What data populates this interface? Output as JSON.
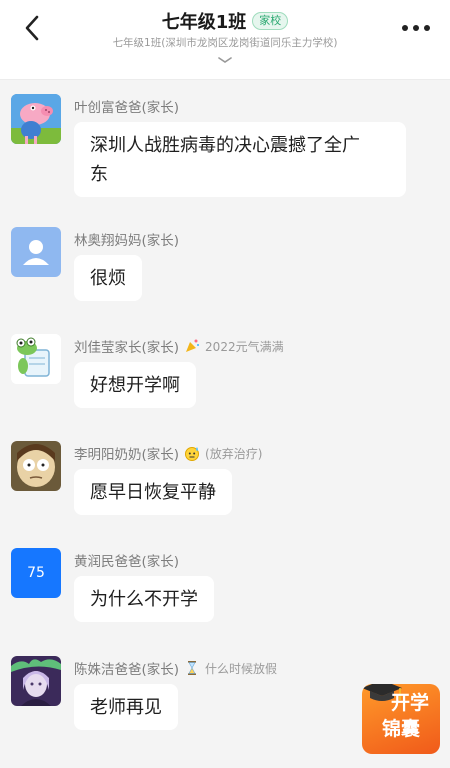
{
  "header": {
    "title": "七年级1班",
    "tag": "家校",
    "subtitle": "七年级1班(深圳市龙岗区龙岗街道同乐主力学校)",
    "back_icon": "chevron-left-icon",
    "more_icon": "more-dots-icon",
    "collapse_icon": "chevron-down-icon"
  },
  "messages": [
    {
      "sender": "叶创富爸爸(家长)",
      "text": "深圳人战胜病毒的决心震撼了全广东",
      "text_line1": "深圳人战胜病毒的决心震撼了全广",
      "text_line2": "东",
      "avatar": "peppa-pig-avatar"
    },
    {
      "sender": "林奥翔妈妈(家长)",
      "text": "很烦",
      "avatar": "default-person-avatar"
    },
    {
      "sender": "刘佳莹家长(家长)",
      "badge": "2022元气满满",
      "text": "好想开学啊",
      "avatar": "frog-cartoon-avatar"
    },
    {
      "sender": "李明阳奶奶(家长)",
      "badge": "(放弃治疗)",
      "text": "愿早日恢复平静",
      "avatar": "cartoon-face-avatar"
    },
    {
      "sender": "黄润民爸爸(家长)",
      "text": "为什么不开学",
      "avatar": "number-avatar",
      "avatar_text": "75"
    },
    {
      "sender": "陈姝洁爸爸(家长)",
      "badge": "什么时候放假",
      "text": "老师再见",
      "avatar": "anime-character-avatar"
    }
  ],
  "floating": {
    "line1": "开学",
    "line2": "锦囊",
    "icon": "graduation-cap-icon"
  },
  "colors": {
    "accent_green": "#2aa870",
    "avatar_blue": "#1677ff",
    "kit_orange": "#f05a1a"
  }
}
